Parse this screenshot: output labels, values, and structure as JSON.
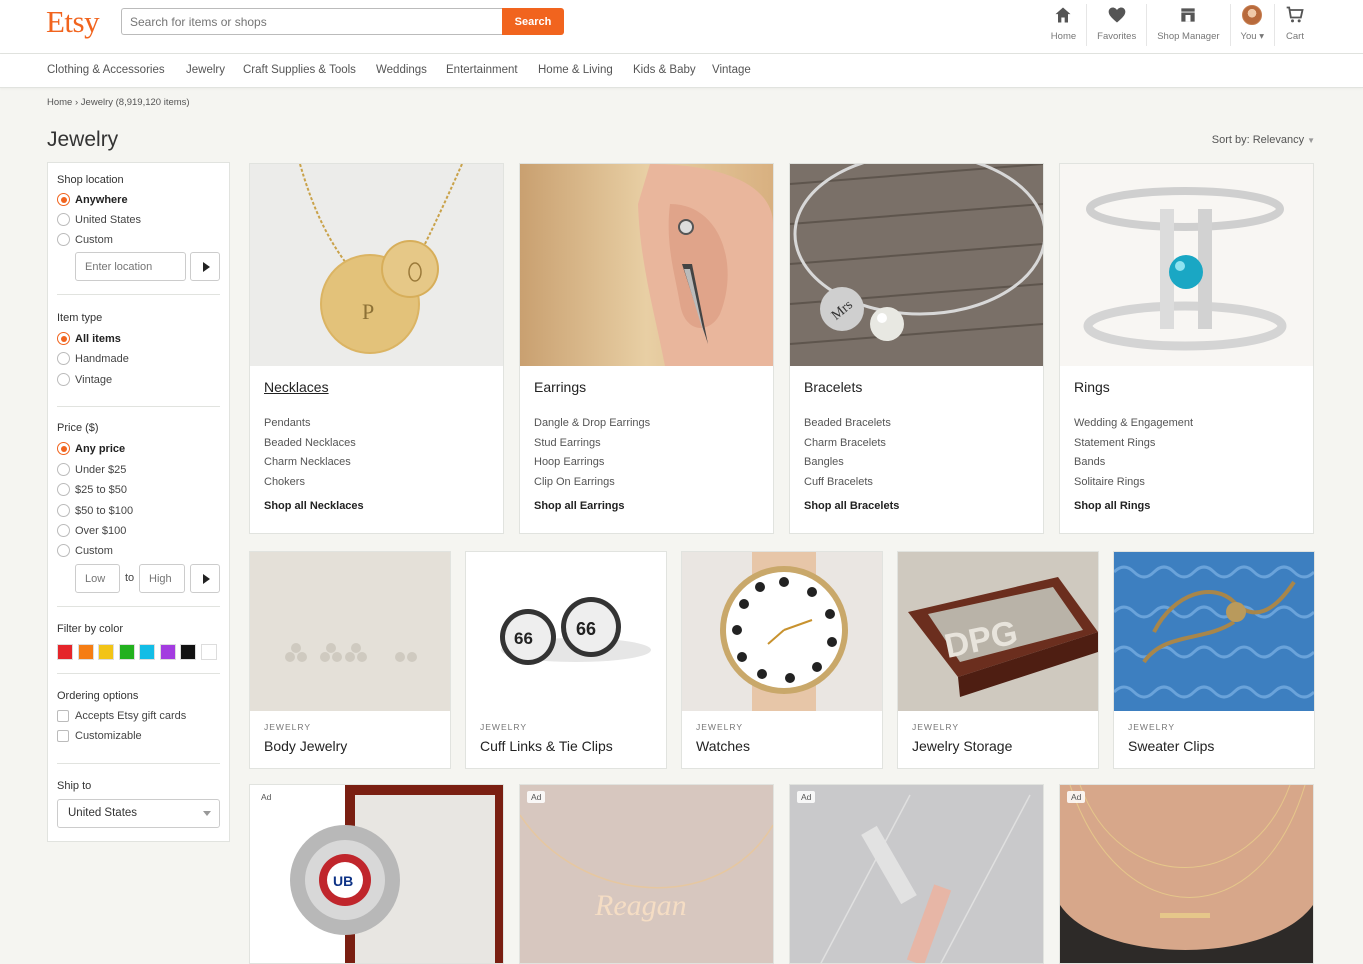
{
  "header": {
    "logo": "Etsy",
    "search_placeholder": "Search for items or shops",
    "search_button": "Search",
    "nav": [
      {
        "label": "Home",
        "icon": "home-icon"
      },
      {
        "label": "Favorites",
        "icon": "heart-icon"
      },
      {
        "label": "Shop Manager",
        "icon": "shop-icon"
      },
      {
        "label": "You ▾",
        "icon": "avatar"
      },
      {
        "label": "Cart",
        "icon": "cart-icon"
      }
    ]
  },
  "categories": [
    "Clothing & Accessories",
    "Jewelry",
    "Craft Supplies & Tools",
    "Weddings",
    "Entertainment",
    "Home & Living",
    "Kids & Baby",
    "Vintage"
  ],
  "breadcrumb": {
    "home": "Home",
    "current": "Jewelry (8,919,120 items)"
  },
  "page_title": "Jewelry",
  "sort": {
    "label": "Sort by: Relevancy"
  },
  "sidebar": {
    "shop_location": {
      "heading": "Shop location",
      "options": [
        "Anywhere",
        "United States",
        "Custom"
      ],
      "selected": "Anywhere",
      "location_placeholder": "Enter location"
    },
    "item_type": {
      "heading": "Item type",
      "options": [
        "All items",
        "Handmade",
        "Vintage"
      ],
      "selected": "All items"
    },
    "price": {
      "heading": "Price ($)",
      "options": [
        "Any price",
        "Under $25",
        "$25 to $50",
        "$50 to $100",
        "Over $100",
        "Custom"
      ],
      "selected": "Any price",
      "low_placeholder": "Low",
      "to_label": "to",
      "high_placeholder": "High"
    },
    "color": {
      "heading": "Filter by color",
      "swatches": [
        "#e5252a",
        "#f57d14",
        "#f2c417",
        "#22b11e",
        "#13bde6",
        "#a33ce0",
        "#111111",
        "#ffffff"
      ]
    },
    "ordering": {
      "heading": "Ordering options",
      "options": [
        "Accepts Etsy gift cards",
        "Customizable"
      ]
    },
    "ship_to": {
      "heading": "Ship to",
      "value": "United States"
    }
  },
  "big_cards": [
    {
      "title": "Necklaces",
      "subs": [
        "Pendants",
        "Beaded Necklaces",
        "Charm Necklaces",
        "Chokers"
      ],
      "shop_all": "Shop all Necklaces"
    },
    {
      "title": "Earrings",
      "subs": [
        "Dangle & Drop Earrings",
        "Stud Earrings",
        "Hoop Earrings",
        "Clip On Earrings"
      ],
      "shop_all": "Shop all Earrings"
    },
    {
      "title": "Bracelets",
      "subs": [
        "Beaded Bracelets",
        "Charm Bracelets",
        "Bangles",
        "Cuff Bracelets"
      ],
      "shop_all": "Shop all Bracelets"
    },
    {
      "title": "Rings",
      "subs": [
        "Wedding & Engagement",
        "Statement Rings",
        "Bands",
        "Solitaire Rings"
      ],
      "shop_all": "Shop all Rings"
    }
  ],
  "small_cards": [
    {
      "category": "JEWELRY",
      "title": "Body Jewelry"
    },
    {
      "category": "JEWELRY",
      "title": "Cuff Links & Tie Clips"
    },
    {
      "category": "JEWELRY",
      "title": "Watches"
    },
    {
      "category": "JEWELRY",
      "title": "Jewelry Storage"
    },
    {
      "category": "JEWELRY",
      "title": "Sweater Clips"
    }
  ],
  "ads": [
    {
      "badge": "Ad"
    },
    {
      "badge": "Ad"
    },
    {
      "badge": "Ad"
    },
    {
      "badge": "Ad"
    }
  ]
}
